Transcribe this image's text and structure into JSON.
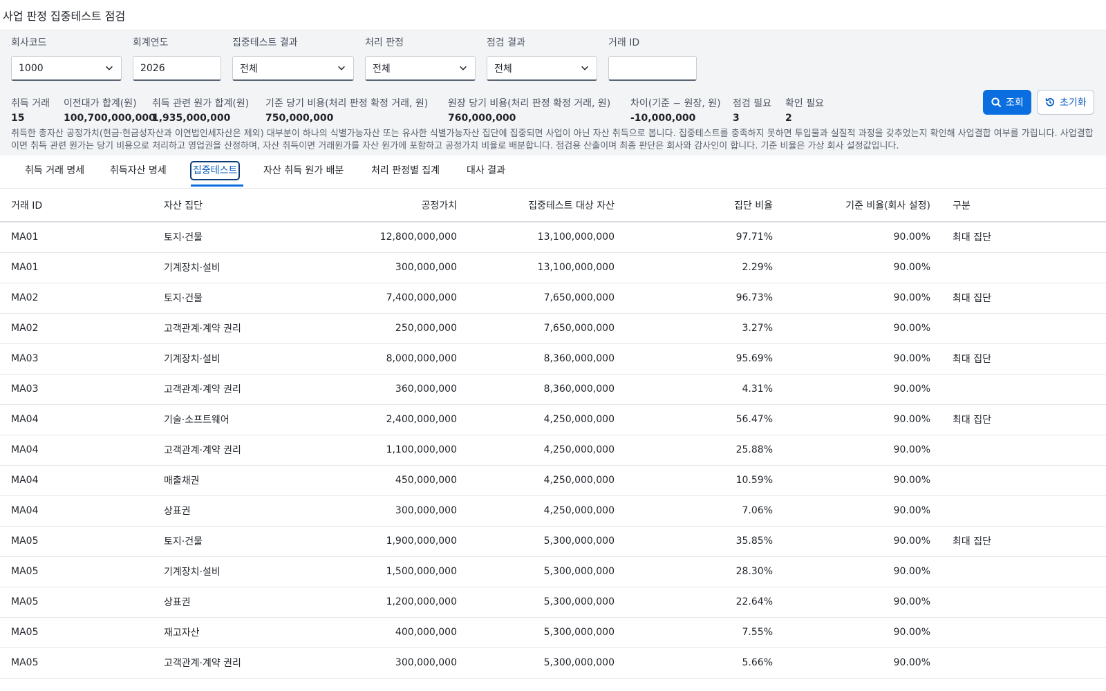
{
  "title": "사업 판정 집중테스트 점검",
  "filters": {
    "company_code": {
      "label": "회사코드",
      "value": "1000"
    },
    "fiscal_year": {
      "label": "회계연도",
      "value": "2026"
    },
    "concentration_result": {
      "label": "집중테스트 결과",
      "value": "전체"
    },
    "treatment": {
      "label": "처리 판정",
      "value": "전체"
    },
    "review_result": {
      "label": "점검 결과",
      "value": "전체"
    },
    "deal_id": {
      "label": "거래 ID",
      "value": ""
    }
  },
  "buttons": {
    "search": "조회",
    "reset": "초기화"
  },
  "summary": [
    {
      "label": "취득 거래",
      "value": "15"
    },
    {
      "label": "이전대가 합계(원)",
      "value": "100,700,000,000"
    },
    {
      "label": "취득 관련 원가 합계(원)",
      "value": "1,935,000,000"
    },
    {
      "label": "기준 당기 비용(처리 판정 확정 거래, 원)",
      "value": "750,000,000"
    },
    {
      "label": "원장 당기 비용(처리 판정 확정 거래, 원)",
      "value": "760,000,000"
    },
    {
      "label": "차이(기준 − 원장, 원)",
      "value": "-10,000,000"
    },
    {
      "label": "점검 필요",
      "value": "3"
    },
    {
      "label": "확인 필요",
      "value": "2"
    }
  ],
  "notice": "취득한 총자산 공정가치(현금·현금성자산과 이연법인세자산은 제외) 대부분이 하나의 식별가능자산 또는 유사한 식별가능자산 집단에 집중되면 사업이 아닌 자산 취득으로 봅니다. 집중테스트를 충족하지 못하면 투입물과 실질적 과정을 갖추었는지 확인해 사업결합 여부를 가립니다. 사업결합이면 취득 관련 원가는 당기 비용으로 처리하고 영업권을 산정하며, 자산 취득이면 거래원가를 자산 원가에 포함하고 공정가치 비율로 배분합니다. 점검용 산출이며 최종 판단은 회사와 감사인이 합니다. 기준 비율은 가상 회사 설정값입니다.",
  "tabs": [
    "취득 거래 명세",
    "취득자산 명세",
    "집중테스트",
    "자산 취득 원가 배분",
    "처리 판정별 집계",
    "대사 결과"
  ],
  "active_tab": "집중테스트",
  "table": {
    "columns": [
      "거래 ID",
      "자산 집단",
      "공정가치",
      "집중테스트 대상 자산",
      "집단 비율",
      "기준 비율(회사 설정)",
      "구분"
    ],
    "rows": [
      [
        "MA01",
        "토지·건물",
        "12,800,000,000",
        "13,100,000,000",
        "97.71%",
        "90.00%",
        "최대 집단"
      ],
      [
        "MA01",
        "기계장치·설비",
        "300,000,000",
        "13,100,000,000",
        "2.29%",
        "90.00%",
        ""
      ],
      [
        "MA02",
        "토지·건물",
        "7,400,000,000",
        "7,650,000,000",
        "96.73%",
        "90.00%",
        "최대 집단"
      ],
      [
        "MA02",
        "고객관계·계약 권리",
        "250,000,000",
        "7,650,000,000",
        "3.27%",
        "90.00%",
        ""
      ],
      [
        "MA03",
        "기계장치·설비",
        "8,000,000,000",
        "8,360,000,000",
        "95.69%",
        "90.00%",
        "최대 집단"
      ],
      [
        "MA03",
        "고객관계·계약 권리",
        "360,000,000",
        "8,360,000,000",
        "4.31%",
        "90.00%",
        ""
      ],
      [
        "MA04",
        "기술·소프트웨어",
        "2,400,000,000",
        "4,250,000,000",
        "56.47%",
        "90.00%",
        "최대 집단"
      ],
      [
        "MA04",
        "고객관계·계약 권리",
        "1,100,000,000",
        "4,250,000,000",
        "25.88%",
        "90.00%",
        ""
      ],
      [
        "MA04",
        "매출채권",
        "450,000,000",
        "4,250,000,000",
        "10.59%",
        "90.00%",
        ""
      ],
      [
        "MA04",
        "상표권",
        "300,000,000",
        "4,250,000,000",
        "7.06%",
        "90.00%",
        ""
      ],
      [
        "MA05",
        "토지·건물",
        "1,900,000,000",
        "5,300,000,000",
        "35.85%",
        "90.00%",
        "최대 집단"
      ],
      [
        "MA05",
        "기계장치·설비",
        "1,500,000,000",
        "5,300,000,000",
        "28.30%",
        "90.00%",
        ""
      ],
      [
        "MA05",
        "상표권",
        "1,200,000,000",
        "5,300,000,000",
        "22.64%",
        "90.00%",
        ""
      ],
      [
        "MA05",
        "재고자산",
        "400,000,000",
        "5,300,000,000",
        "7.55%",
        "90.00%",
        ""
      ],
      [
        "MA05",
        "고객관계·계약 권리",
        "300,000,000",
        "5,300,000,000",
        "5.66%",
        "90.00%",
        ""
      ]
    ]
  }
}
